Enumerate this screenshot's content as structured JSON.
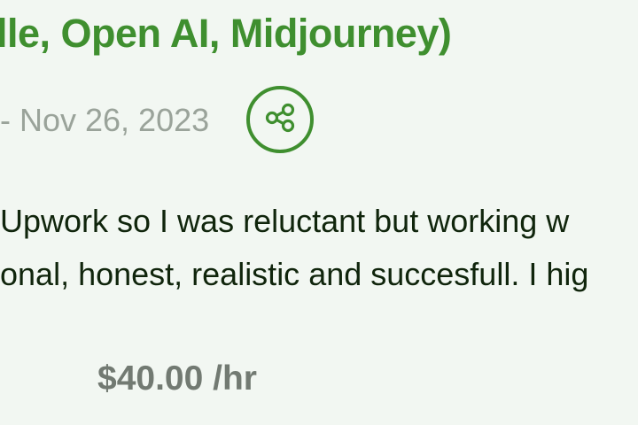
{
  "header": {
    "title_fragment": "lle, Open AI, Midjourney)"
  },
  "meta": {
    "date_fragment": "- Nov 26, 2023",
    "share_icon": "share-icon"
  },
  "review": {
    "line1": "Upwork so I was reluctant but working w",
    "line2": "onal, honest, realistic and succesfull. I hig"
  },
  "rate": {
    "price": "$40.00 /hr"
  },
  "colors": {
    "accent": "#3f8f2f",
    "muted": "#9aa39a",
    "text": "#10250c"
  }
}
